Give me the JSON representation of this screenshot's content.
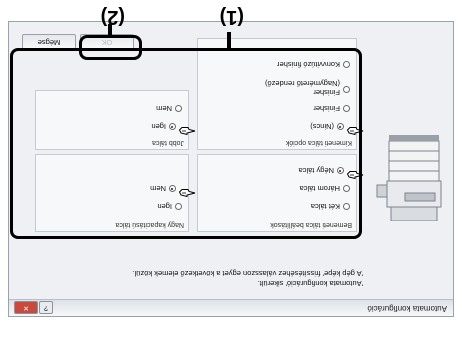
{
  "window": {
    "title": "Automata konfiguráció",
    "help_label": "?",
    "close_label": "✕"
  },
  "instruction": {
    "line1": "'Automata konfiguráció' sikerült.",
    "line2": "'A gép képe' frissítéséhez válasszon egyet a következő elemek közül."
  },
  "bottom_tray": {
    "title": "Bemeneti tálca beállítások",
    "options": [
      {
        "label": "Két tálca",
        "selected": false
      },
      {
        "label": "Három tálca",
        "selected": false
      },
      {
        "label": "Négy tálca",
        "selected": true
      }
    ]
  },
  "large_tray": {
    "title": "Nagy kapacitású tálca",
    "options": [
      {
        "label": "Igen",
        "selected": false
      },
      {
        "label": "Nem",
        "selected": true
      }
    ]
  },
  "output_tray": {
    "title": "Kimeneti tálca opciók",
    "options": [
      {
        "label": "(Nincs)",
        "selected": true
      },
      {
        "label": "Finisher",
        "selected": false
      },
      {
        "label": "Finisher (Nagymérető rendező)",
        "line1": "Finisher",
        "line2": "(Nagymérető rendező)",
        "selected": false
      },
      {
        "label": "Konvvitúzó finisher",
        "selected": false
      }
    ]
  },
  "right_tray": {
    "title": "Jobb tálca",
    "options": [
      {
        "label": "Igen",
        "selected": true
      },
      {
        "label": "Nem",
        "selected": false
      }
    ]
  },
  "buttons": {
    "ok": "OK",
    "cancel": "Mégse"
  },
  "markers": {
    "one": "(1)",
    "two": "(2)"
  }
}
